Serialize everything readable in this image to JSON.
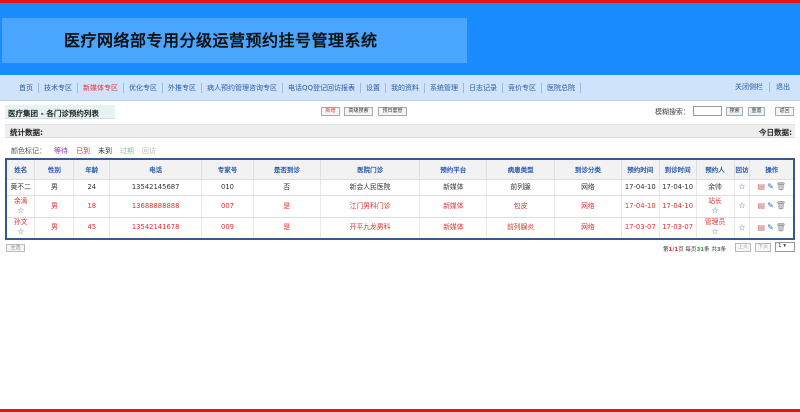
{
  "header": {
    "title": "医疗网络部专用分级运营预约挂号管理系统"
  },
  "nav": {
    "items": [
      "首页",
      "技术专区",
      "新媒体专区",
      "优化专区",
      "外推专区",
      "病人预约管理咨询专区",
      "电话QQ登记回访报表",
      "设置",
      "我的资料",
      "系统管理",
      "日志记录",
      "竞价专区",
      "医院总院"
    ],
    "active": "新媒体专区",
    "right": [
      "关闭侧栏",
      "退出"
    ]
  },
  "page": {
    "subtitle": "医疗集团 - 各门诊预约列表",
    "add": "新增",
    "advanced_search": "高级搜索",
    "report": "预日套管",
    "search_label": "模糊搜索：",
    "search_value": "",
    "search_btn": "搜索",
    "reset_btn": "重置",
    "back_btn": "返回"
  },
  "stats": {
    "left": "统计数据:",
    "right": "今日数据:"
  },
  "legend": {
    "label": "颜色标记：",
    "items": [
      {
        "text": "等待",
        "color": "#9933cc"
      },
      {
        "text": "已到",
        "color": "#dd3333"
      },
      {
        "text": "未到",
        "color": "#333333"
      },
      {
        "text": "过期",
        "color": "#88bbbb"
      },
      {
        "text": "回访",
        "color": "#bbbbbb"
      }
    ]
  },
  "table": {
    "headers": [
      "姓名",
      "性别",
      "年龄",
      "电话",
      "专家号",
      "是否到诊",
      "医院门诊",
      "预约平台",
      "病患类型",
      "到诊分类",
      "预约时间",
      "到诊时间",
      "预约人",
      "回访",
      "操作"
    ],
    "rows": [
      {
        "status": "black",
        "name": "黄不二",
        "name_star": false,
        "gender": "男",
        "age": "24",
        "phone": "13542145687",
        "expert": "010",
        "arrived": "否",
        "clinic": "新会人民医院",
        "platform": "新媒体",
        "type": "前列腺",
        "category": "网络",
        "book_time": "17-04-10",
        "visit_time": "17-04-10",
        "booker": "余帅",
        "booker_star": false
      },
      {
        "status": "red",
        "name": "余滴",
        "name_star": true,
        "gender": "男",
        "age": "18",
        "phone": "13688888888",
        "expert": "007",
        "arrived": "是",
        "clinic": "江门男科门诊",
        "platform": "新媒体",
        "type": "包皮",
        "category": "网络",
        "book_time": "17-04-10",
        "visit_time": "17-04-10",
        "booker": "站长",
        "booker_star": true
      },
      {
        "status": "red",
        "name": "孙文",
        "name_star": true,
        "gender": "男",
        "age": "45",
        "phone": "13542141678",
        "expert": "009",
        "arrived": "是",
        "clinic": "开平九龙男科",
        "platform": "新媒体",
        "type": "前列腺炎",
        "category": "网络",
        "book_time": "17-03-07",
        "visit_time": "17-03-07",
        "booker": "管理员",
        "booker_star": true
      }
    ]
  },
  "footer": {
    "select_all": "全选",
    "page_prefix": "第",
    "page_current": "1/1",
    "page_suffix": "页 每页",
    "per_page": "31",
    "per_suffix": "条 共",
    "total": "3",
    "total_suffix": "条",
    "prev": "上页",
    "next": "下页",
    "page_select": "1"
  }
}
